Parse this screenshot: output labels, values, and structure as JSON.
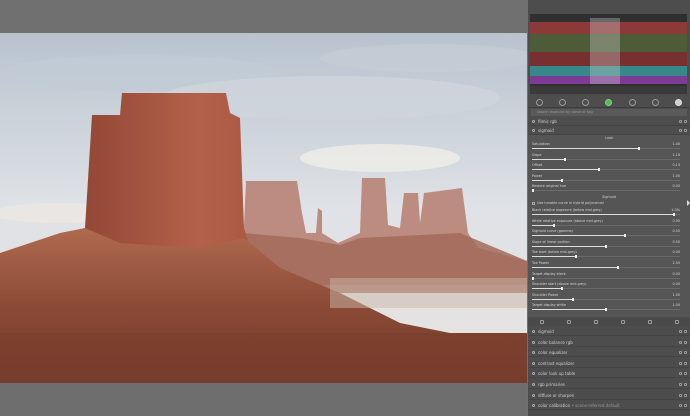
{
  "panel": {
    "search_placeholder": "search modules by name or tag",
    "modules_top": [
      {
        "label": "filmic rgb"
      },
      {
        "label": "sigmoid"
      }
    ],
    "sigmoid": {
      "look_section": "Look",
      "sliders_look": [
        {
          "label": "Saturation",
          "value": "1.40",
          "fraction": 0.72
        },
        {
          "label": "Slope",
          "value": "1.16",
          "fraction": 0.22
        },
        {
          "label": "Offset",
          "value": "0.13",
          "fraction": 0.45
        },
        {
          "label": "Power",
          "value": "1.00",
          "fraction": 0.2
        },
        {
          "label": "Restore original hue",
          "value": "0.00",
          "fraction": 0.0
        }
      ],
      "sigmoid_section": "Sigmoid",
      "checkbox_label": "Use tunable curve in hybrid polynomial",
      "sliders_sigmoid": [
        {
          "label": "Black relative exposure (below mid-grey)",
          "value": "1.0%",
          "fraction": 0.96
        },
        {
          "label": "White relative exposure (above mid-grey)",
          "value": "0.95",
          "fraction": 0.15
        },
        {
          "label": "Sigmoid curve (gamma)",
          "value": "0.50",
          "fraction": 0.63
        },
        {
          "label": "Slope of linear portion",
          "value": "0.50",
          "fraction": 0.5
        },
        {
          "label": "Toe start (below mid-grey)",
          "value": "0.00",
          "fraction": 0.3
        },
        {
          "label": "Toe Power",
          "value": "2.50",
          "fraction": 0.58
        },
        {
          "label": "Target display black",
          "value": "0.00",
          "fraction": 0.0
        },
        {
          "label": "Shoulder start (above mid-grey)",
          "value": "0.00",
          "fraction": 0.2
        },
        {
          "label": "Shoulder Power",
          "value": "1.00",
          "fraction": 0.28
        },
        {
          "label": "Target display white",
          "value": "1.00",
          "fraction": 0.5
        }
      ]
    },
    "modules_bottom": [
      {
        "label": "sigmoid"
      },
      {
        "label": "color balance rgb"
      },
      {
        "label": "color equalizer"
      },
      {
        "label": "contrast equalizer"
      },
      {
        "label": "color look up table"
      },
      {
        "label": "rgb primaries"
      },
      {
        "label": "diffuse or sharpen"
      },
      {
        "label": "color calibration"
      }
    ],
    "color_calibration_note": "• scene-referred default"
  },
  "colors": {
    "panel_bg": "#4d4d4d",
    "module_bg": "#555555",
    "app_bg": "#707070"
  }
}
